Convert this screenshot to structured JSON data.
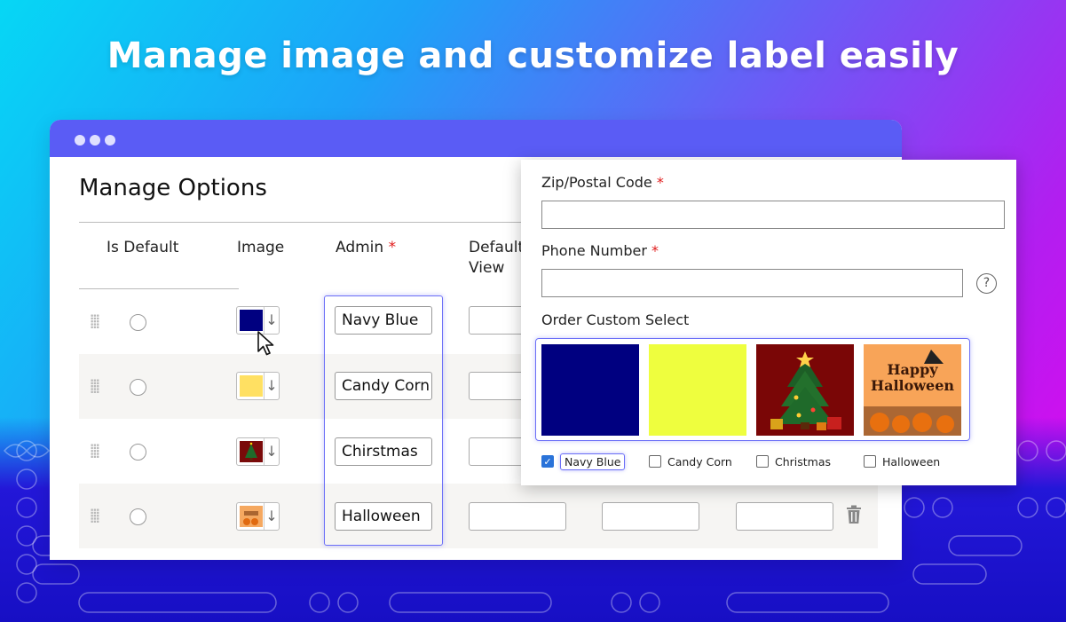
{
  "headline": "Manage image and customize label easily",
  "manage": {
    "title": "Manage Options",
    "columns": {
      "is_default": "Is Default",
      "image": "Image",
      "admin": "Admin",
      "default_view_line1": "Default",
      "default_view_line2": "View"
    },
    "required_mark": "*",
    "rows": [
      {
        "name": "Navy Blue",
        "swatch": "navy"
      },
      {
        "name": "Candy Corn",
        "swatch": "yellow"
      },
      {
        "name": "Chirstmas",
        "swatch": "christmas"
      },
      {
        "name": "Halloween",
        "swatch": "halloween"
      }
    ],
    "arrow_glyph": "↓"
  },
  "form": {
    "zip_label": "Zip/Postal Code",
    "phone_label": "Phone Number",
    "select_label": "Order Custom Select",
    "help_glyph": "?",
    "check_glyph": "✓",
    "halloween_line1": "Happy",
    "halloween_line2": "Halloween",
    "options": [
      {
        "label": "Navy Blue",
        "checked": true
      },
      {
        "label": "Candy Corn",
        "checked": false
      },
      {
        "label": "Christmas",
        "checked": false
      },
      {
        "label": "Halloween",
        "checked": false
      }
    ]
  },
  "colors": {
    "navy": "#000080",
    "yellow": "#eefe3e",
    "candy_swatch": "#ffe062",
    "accent": "#5a5cf5",
    "required": "#e01b1b"
  }
}
